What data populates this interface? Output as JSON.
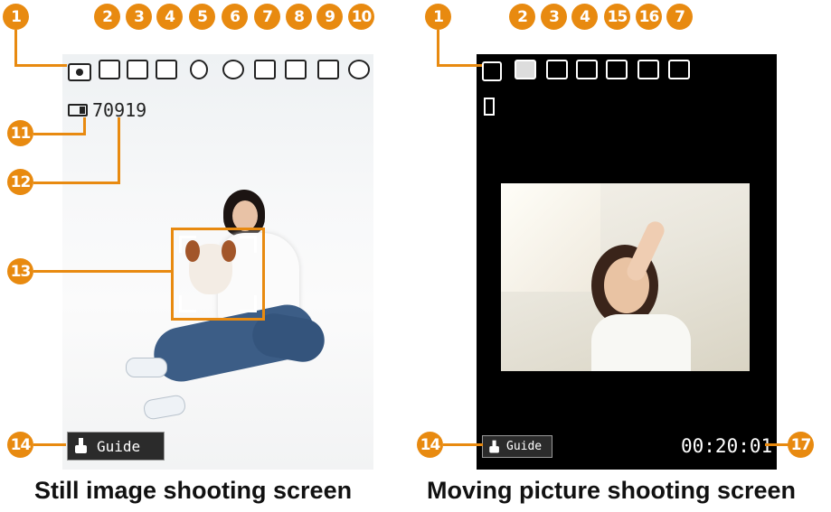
{
  "still": {
    "caption": "Still image shooting screen",
    "counter": "70919",
    "guide_label": "Guide",
    "badges": [
      "1",
      "2",
      "3",
      "4",
      "5",
      "6",
      "7",
      "8",
      "9",
      "10",
      "11",
      "12",
      "13",
      "14"
    ]
  },
  "movie": {
    "caption": "Moving picture shooting screen",
    "timer": "00:20:01",
    "guide_label": "Guide",
    "badges": [
      "1",
      "2",
      "3",
      "4",
      "15",
      "16",
      "7",
      "14",
      "17"
    ]
  },
  "colors": {
    "accent": "#e88a10"
  }
}
